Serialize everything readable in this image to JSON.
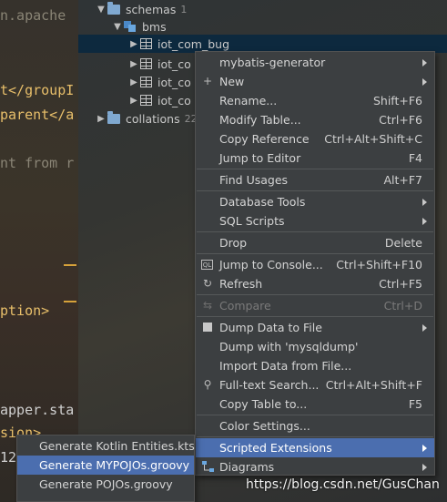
{
  "editor": {
    "lines": [
      "n.apache",
      "t</groupI",
      "parent</a",
      "nt from r",
      "ption>",
      "apper.sta",
      "sion>",
      "12"
    ]
  },
  "tree": {
    "nodes": [
      {
        "label": "schemas",
        "count": "1"
      },
      {
        "label": "bms",
        "count": ""
      },
      {
        "label": "iot_com_bug",
        "count": ""
      },
      {
        "label": "iot_co",
        "count": ""
      },
      {
        "label": "iot_co",
        "count": ""
      },
      {
        "label": "iot_co",
        "count": ""
      },
      {
        "label": "collations",
        "count": "22"
      }
    ]
  },
  "context_menu": {
    "items": [
      {
        "label": "mybatis-generator",
        "shortcut": "",
        "icon": "",
        "submenu": true
      },
      {
        "label": "New",
        "shortcut": "",
        "icon": "plus-icon",
        "submenu": true
      },
      {
        "label": "Rename...",
        "shortcut": "Shift+F6",
        "icon": "",
        "submenu": false
      },
      {
        "label": "Modify Table...",
        "shortcut": "Ctrl+F6",
        "icon": "",
        "submenu": false
      },
      {
        "label": "Copy Reference",
        "shortcut": "Ctrl+Alt+Shift+C",
        "icon": "",
        "submenu": false
      },
      {
        "label": "Jump to Editor",
        "shortcut": "F4",
        "icon": "",
        "submenu": false
      },
      {
        "label": "Find Usages",
        "shortcut": "Alt+F7",
        "icon": "",
        "submenu": false
      },
      {
        "label": "Database Tools",
        "shortcut": "",
        "icon": "",
        "submenu": true
      },
      {
        "label": "SQL Scripts",
        "shortcut": "",
        "icon": "",
        "submenu": true
      },
      {
        "label": "Drop",
        "shortcut": "Delete",
        "icon": "",
        "submenu": false
      },
      {
        "label": "Jump to Console...",
        "shortcut": "Ctrl+Shift+F10",
        "icon": "console-icon",
        "submenu": false
      },
      {
        "label": "Refresh",
        "shortcut": "Ctrl+F5",
        "icon": "refresh-icon",
        "submenu": false
      },
      {
        "label": "Compare",
        "shortcut": "Ctrl+D",
        "icon": "compare-icon",
        "submenu": false,
        "disabled": true
      },
      {
        "label": "Dump Data to File",
        "shortcut": "",
        "icon": "dump-icon",
        "submenu": true
      },
      {
        "label": "Dump with 'mysqldump'",
        "shortcut": "",
        "icon": "",
        "submenu": false
      },
      {
        "label": "Import Data from File...",
        "shortcut": "",
        "icon": "",
        "submenu": false
      },
      {
        "label": "Full-text Search...",
        "shortcut": "Ctrl+Alt+Shift+F",
        "icon": "search-icon",
        "submenu": false
      },
      {
        "label": "Copy Table to...",
        "shortcut": "F5",
        "icon": "",
        "submenu": false
      },
      {
        "label": "Color Settings...",
        "shortcut": "",
        "icon": "",
        "submenu": false
      },
      {
        "label": "Scripted Extensions",
        "shortcut": "",
        "icon": "",
        "submenu": true,
        "highlighted": true
      },
      {
        "label": "Diagrams",
        "shortcut": "",
        "icon": "diagram-icon",
        "submenu": true
      }
    ]
  },
  "submenu": {
    "items": [
      {
        "label": "Generate Kotlin Entities.kts",
        "highlighted": false
      },
      {
        "label": "Generate MYPOJOs.groovy",
        "highlighted": true
      },
      {
        "label": "Generate POJOs.groovy",
        "highlighted": false
      }
    ]
  },
  "watermark": "https://blog.csdn.net/GusChan",
  "colors": {
    "highlight": "#4b6eaf",
    "menu_bg": "#3c3f41",
    "selection": "#0d293e"
  }
}
